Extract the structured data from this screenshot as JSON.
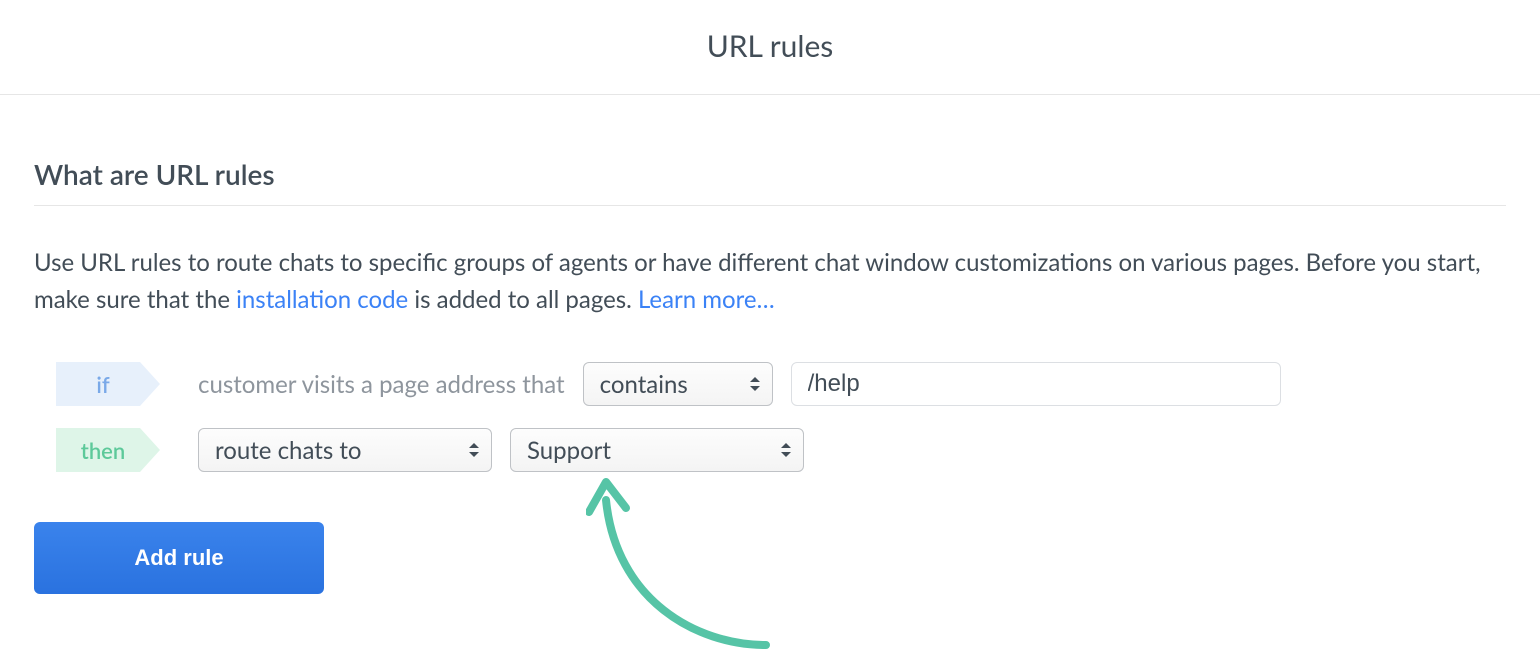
{
  "header": {
    "title": "URL rules"
  },
  "section": {
    "title": "What are URL rules"
  },
  "description": {
    "part1": "Use URL rules to route chats to specific groups of agents or have different chat window customizations on various pages. Before you start, make sure that the ",
    "link1": "installation code",
    "part2": " is added to all pages. ",
    "link2": "Learn more…"
  },
  "rule": {
    "if_label": "if",
    "then_label": "then",
    "condition_text": "customer visits a page address that",
    "match_select": "contains",
    "match_value": "/help",
    "action_select": "route chats to",
    "target_select": "Support"
  },
  "buttons": {
    "add_rule": "Add rule"
  },
  "colors": {
    "if_bg": "#e7f0fb",
    "then_bg": "#def5e8",
    "link": "#3b82f6",
    "primary": "#2b78e4",
    "arrow": "#56c4a6"
  }
}
